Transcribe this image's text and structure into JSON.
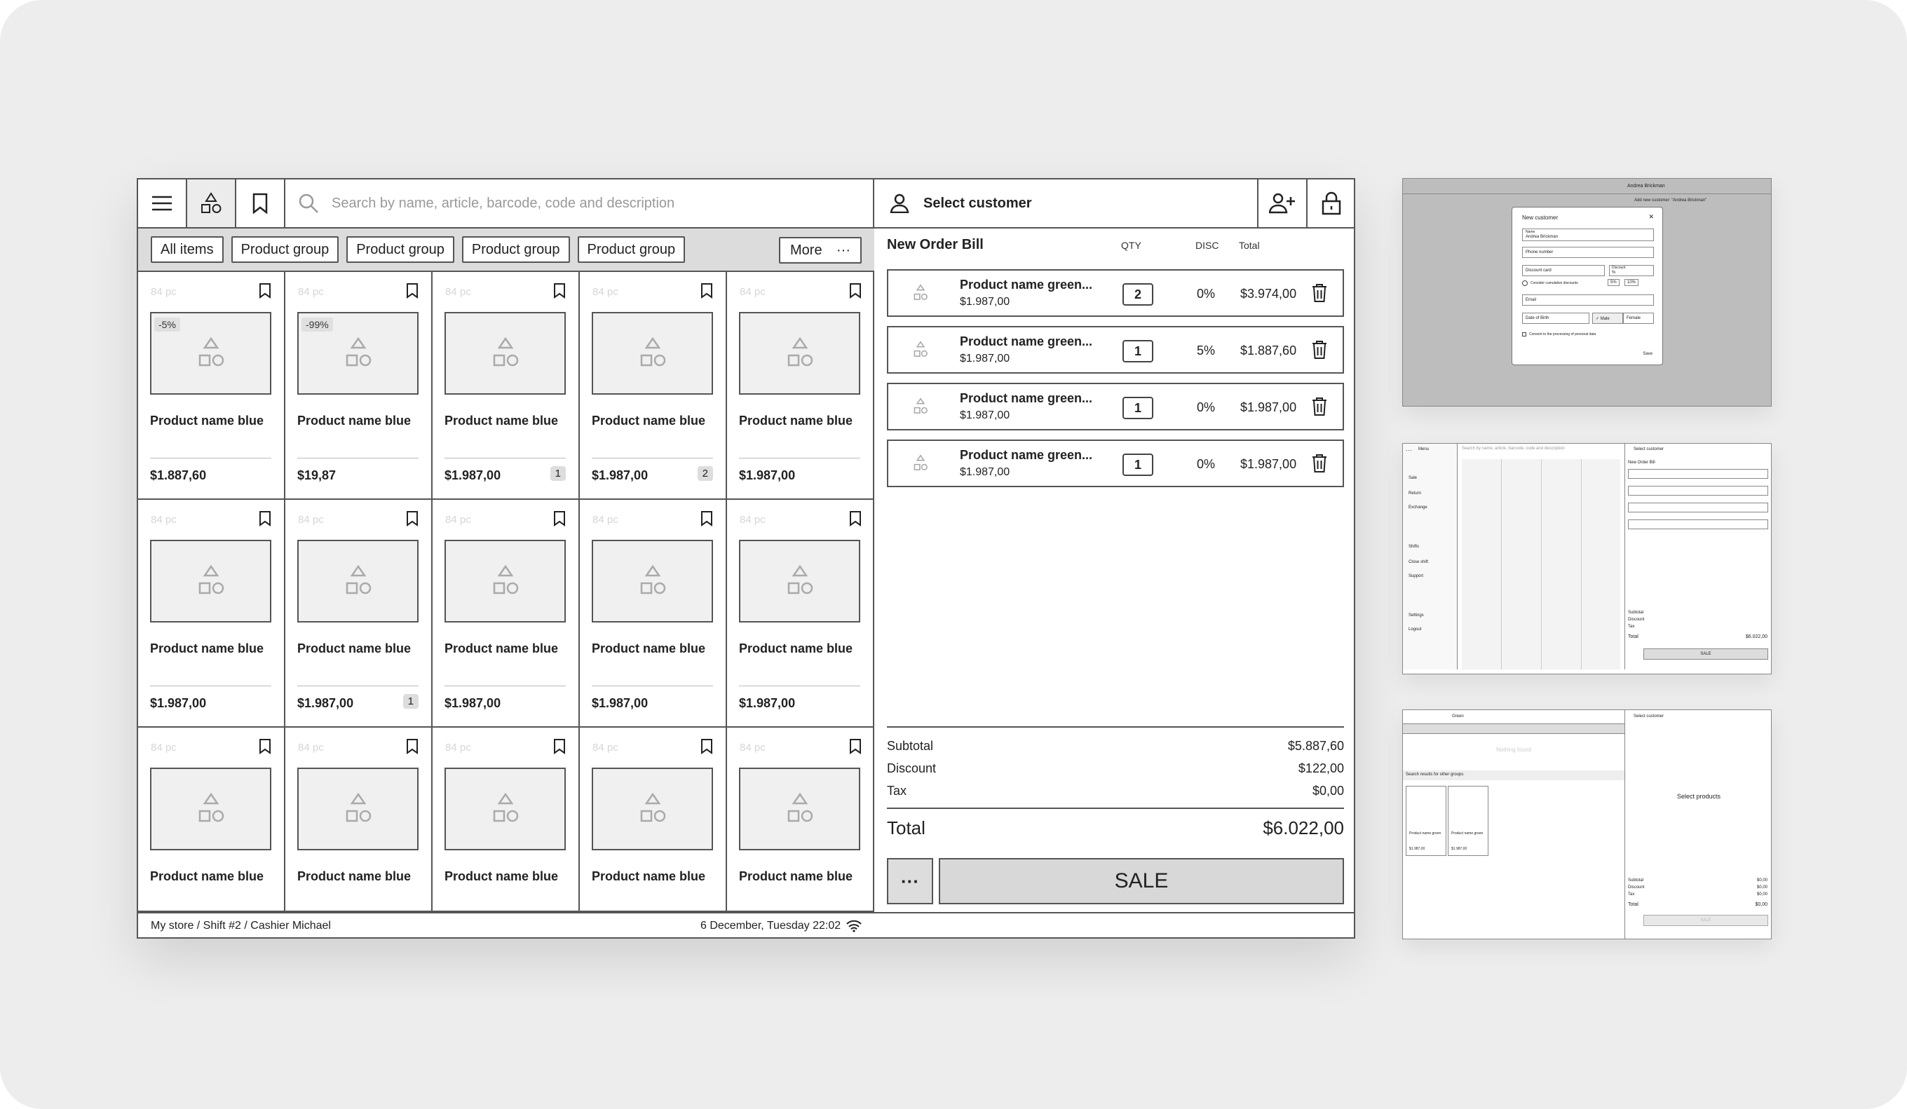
{
  "toolbar": {
    "menu_icon": "hamburger-icon",
    "catalog_icon": "shapes-icon",
    "bookmark_icon": "bookmark-icon",
    "search_placeholder": "Search by name, article, barcode, code and description"
  },
  "groups": {
    "all": "All items",
    "items": [
      "Product group",
      "Product group",
      "Product group",
      "Product group"
    ],
    "more": "More"
  },
  "products": [
    {
      "count": "84 pc",
      "discount": "-5%",
      "name": "Product name blue",
      "price": "$1.887,60",
      "qty": ""
    },
    {
      "count": "84 pc",
      "discount": "-99%",
      "name": "Product name blue",
      "price": "$19,87",
      "qty": ""
    },
    {
      "count": "84 pc",
      "discount": "",
      "name": "Product name blue",
      "price": "$1.987,00",
      "qty": "1"
    },
    {
      "count": "84 pc",
      "discount": "",
      "name": "Product name blue",
      "price": "$1.987,00",
      "qty": "2"
    },
    {
      "count": "84 pc",
      "discount": "",
      "name": "Product name blue",
      "price": "$1.987,00",
      "qty": ""
    },
    {
      "count": "84 pc",
      "discount": "",
      "name": "Product name blue",
      "price": "$1.987,00",
      "qty": ""
    },
    {
      "count": "84 pc",
      "discount": "",
      "name": "Product name blue",
      "price": "$1.987,00",
      "qty": "1"
    },
    {
      "count": "84 pc",
      "discount": "",
      "name": "Product name blue",
      "price": "$1.987,00",
      "qty": ""
    },
    {
      "count": "84 pc",
      "discount": "",
      "name": "Product name blue",
      "price": "$1.987,00",
      "qty": ""
    },
    {
      "count": "84 pc",
      "discount": "",
      "name": "Product name blue",
      "price": "$1.987,00",
      "qty": ""
    },
    {
      "count": "84 pc",
      "discount": "",
      "name": "Product name blue",
      "price": "",
      "qty": ""
    },
    {
      "count": "84 pc",
      "discount": "",
      "name": "Product name blue",
      "price": "",
      "qty": ""
    },
    {
      "count": "84 pc",
      "discount": "",
      "name": "Product name blue",
      "price": "",
      "qty": ""
    },
    {
      "count": "84 pc",
      "discount": "",
      "name": "Product name blue",
      "price": "",
      "qty": ""
    },
    {
      "count": "84 pc",
      "discount": "",
      "name": "Product name blue",
      "price": "",
      "qty": ""
    }
  ],
  "order": {
    "select_customer": "Select customer",
    "title": "New Order Bill",
    "col_qty": "QTY",
    "col_disc": "DISC",
    "col_total": "Total",
    "lines": [
      {
        "name": "Product name green...",
        "unit": "$1.987,00",
        "qty": "2",
        "disc": "0%",
        "total": "$3.974,00"
      },
      {
        "name": "Product name green...",
        "unit": "$1.987,00",
        "qty": "1",
        "disc": "5%",
        "total": "$1.887,60"
      },
      {
        "name": "Product name green...",
        "unit": "$1.987,00",
        "qty": "1",
        "disc": "0%",
        "total": "$1.987,00"
      },
      {
        "name": "Product name green...",
        "unit": "$1.987,00",
        "qty": "1",
        "disc": "0%",
        "total": "$1.987,00"
      }
    ],
    "subtotal_label": "Subtotal",
    "subtotal": "$5.887,60",
    "discount_label": "Discount",
    "discount": "$122,00",
    "tax_label": "Tax",
    "tax": "$0,00",
    "total_label": "Total",
    "total": "$6.022,00",
    "more_label": "···",
    "sale_label": "SALE"
  },
  "status": {
    "store": "My store / Shift #2 / Cashier Michael",
    "datetime": "6 December, Tuesday 22:02"
  },
  "thumb1": {
    "dialog_title": "New customer",
    "name_label": "Name",
    "name_value": "Andrea Brickman",
    "phone": "Phone number",
    "card": "Discount card",
    "discount": "Discount",
    "pct": "%",
    "cumulative": "Consider cumulative discounts",
    "p5": "5%",
    "p10": "10%",
    "email": "Email",
    "dob": "Date of Birth",
    "male": "Male",
    "female": "Female",
    "consent": "Consent to the processing of personal data",
    "save": "Save",
    "header_name": "Andrea Brickman",
    "add_customer": "Add new customer: \"Andrea Brickman\""
  },
  "thumb2": {
    "menu_title": "Menu",
    "items": [
      "Sale",
      "Return",
      "Exchange",
      "Shifts",
      "Close shift",
      "Support",
      "Settings",
      "Logout"
    ],
    "search": "Search by name, article, barcode, code and description",
    "select_customer": "Select customer",
    "bill": "New Order Bill",
    "subtotal": "Subtotal",
    "discount": "Discount",
    "tax": "Tax",
    "total": "Total",
    "total_value": "$6.022,00",
    "sale": "SALE"
  },
  "thumb3": {
    "query": "Green",
    "nothing": "Nothing found",
    "other_groups": "Search results for other groups",
    "p1": "Product name green",
    "p2": "Product name green",
    "price": "$1.987,00",
    "select_customer": "Select customer",
    "select_products": "Select products",
    "subtotal": "Subtotal",
    "discount": "Discount",
    "tax": "Tax",
    "total": "Total",
    "zero": "$0,00",
    "sale": "SALE"
  }
}
